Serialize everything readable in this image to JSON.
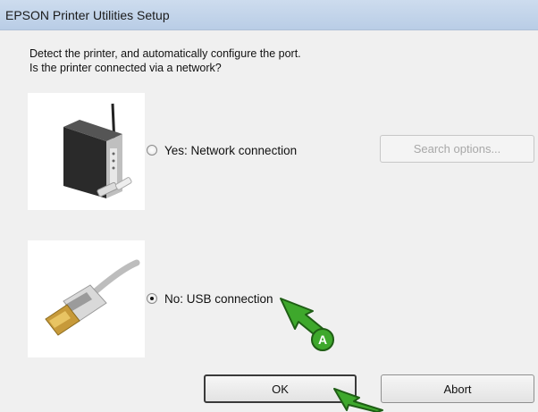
{
  "window": {
    "title": "EPSON Printer Utilities Setup"
  },
  "instructions": {
    "line1": "Detect the printer, and automatically configure the port.",
    "line2": "Is the printer connected via a network?"
  },
  "options": [
    {
      "label": "Yes: Network connection",
      "selected": false,
      "icon": "network-printer-icon"
    },
    {
      "label": "No: USB connection",
      "selected": true,
      "icon": "usb-cable-icon"
    }
  ],
  "buttons": {
    "search_options": "Search options...",
    "ok": "OK",
    "abort": "Abort"
  },
  "annotation": {
    "label": "A",
    "color": "#3ea82c"
  }
}
